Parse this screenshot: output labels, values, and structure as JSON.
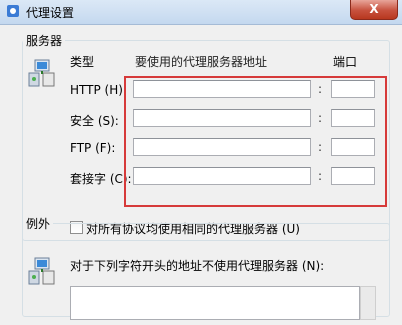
{
  "window": {
    "title": "代理设置",
    "close_glyph": "X"
  },
  "servers": {
    "legend": "服务器",
    "header_type": "类型",
    "header_address": "要使用的代理服务器地址",
    "header_port": "端口",
    "rows": [
      {
        "label": "HTTP (H):",
        "address": "",
        "port": ""
      },
      {
        "label": "安全 (S):",
        "address": "",
        "port": ""
      },
      {
        "label": "FTP (F):",
        "address": "",
        "port": ""
      },
      {
        "label": "套接字 (C):",
        "address": "",
        "port": ""
      }
    ],
    "colon": ":",
    "same_proxy_label": "对所有协议均使用相同的代理服务器 (U)",
    "same_proxy_checked": false
  },
  "exceptions": {
    "legend": "例外",
    "description": "对于下列字符开头的地址不使用代理服务器 (N):",
    "value": ""
  },
  "annotation": {
    "highlight_color": "#d63a3a"
  }
}
